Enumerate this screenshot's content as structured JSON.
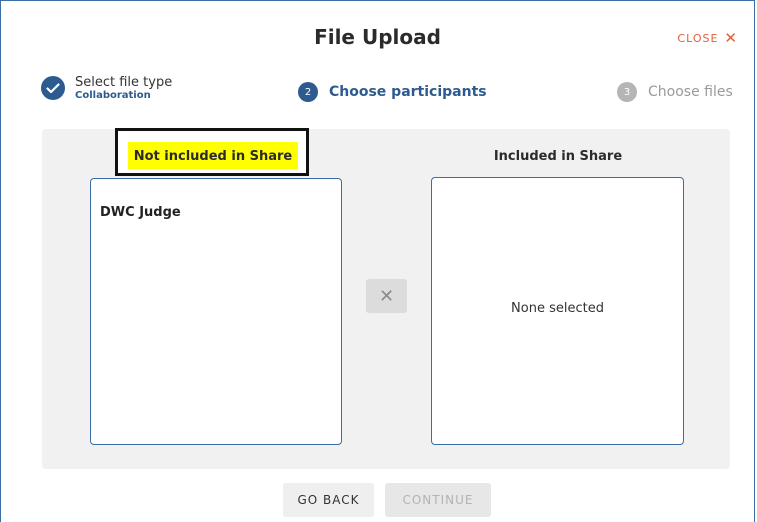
{
  "modal": {
    "title": "File Upload",
    "close_label": "CLOSE",
    "close_glyph": "✕"
  },
  "steps": [
    {
      "label": "Select file type",
      "sub": "Collaboration",
      "state": "done",
      "icon": "check-icon"
    },
    {
      "number": "2",
      "label": "Choose participants",
      "state": "active"
    },
    {
      "number": "3",
      "label": "Choose files",
      "state": "pending"
    }
  ],
  "columns": {
    "left_header": "Not included in Share",
    "right_header": "Included in Share",
    "left_items": [
      "DWC Judge"
    ],
    "right_empty": "None selected"
  },
  "transfer_glyph": "✕",
  "buttons": {
    "back": "GO BACK",
    "continue": "CONTINUE"
  },
  "colors": {
    "accent": "#2d5b8f",
    "close": "#e0603a",
    "highlight": "#ffff00"
  }
}
